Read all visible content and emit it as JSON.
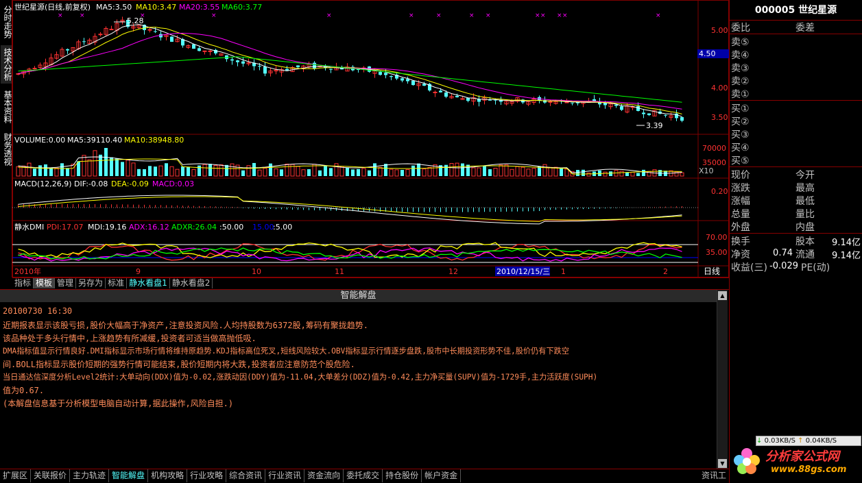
{
  "left_tabs": [
    "分时走势",
    "技术分析",
    "基本资料",
    "财务透视"
  ],
  "main_chart": {
    "title": "世纪星源(日线,前复权)",
    "ma5": "MA5:3.50",
    "ma10": "MA10:3.47",
    "ma20": "MA20:3.55",
    "ma60": "MA60:3.77",
    "high_label": "5.28",
    "low_label": "3.39",
    "price_ticks": [
      "5.00",
      "4.50",
      "4.00",
      "3.50"
    ],
    "current_price_tag": "4.50"
  },
  "volume_chart": {
    "title": "VOLUME:0.00",
    "ma5": "MA5:39110.40",
    "ma10": "MA10:38948.80",
    "ticks": [
      "70000",
      "35000"
    ],
    "unit": "X10"
  },
  "macd_chart": {
    "title": "MACD(12,26,9)",
    "dif": "DIF:-0.08",
    "dea": "DEA:-0.09",
    "macd": "MACD:0.03",
    "ticks": [
      "0.20"
    ]
  },
  "dmi_chart": {
    "title": "静水DMI",
    "pdi": "PDI:17.07",
    "mdi": "MDI:19.16",
    "adx": "ADX:16.12",
    "adxr": "ADXR:26.04",
    "l50": ":50.00",
    "l15": "15.00",
    "l5": ":5.00",
    "ticks": [
      "70.00",
      "35.00"
    ]
  },
  "time_axis": {
    "labels": [
      "2010年",
      "9",
      "10",
      "11",
      "12",
      "1",
      "2"
    ],
    "cursor_date": "2010/12/15/三",
    "period": "日线"
  },
  "chart_tabs": [
    "指标",
    "模板",
    "管理",
    "另存为",
    "标准",
    "静水看盘1",
    "静水看盘2"
  ],
  "quote": {
    "code_name": "000005 世纪星源",
    "weibi": "委比",
    "weicha": "委差",
    "sell": [
      "卖⑤",
      "卖④",
      "卖③",
      "卖②",
      "卖①"
    ],
    "buy": [
      "买①",
      "买②",
      "买③",
      "买④",
      "买⑤"
    ],
    "stats_left": [
      "现价",
      "涨跌",
      "涨幅",
      "总量",
      "外盘"
    ],
    "stats_right": [
      "今开",
      "最高",
      "最低",
      "量比",
      "内盘"
    ],
    "huanshou": "换手",
    "guben": "股本",
    "guben_val": "9.14亿",
    "jingzi": "净资",
    "jingzi_val": "0.74",
    "liutong": "流通",
    "liutong_val": "9.14亿",
    "shouyi": "收益(三)",
    "shouyi_val": "-0.029",
    "pe": "PE(动)"
  },
  "panel": {
    "title": "智能解盘",
    "lines": [
      "20100730 16:30",
      "    近期报表显示该股亏损,股价大幅高于净资产,注意投资风险.人均持股数为6372股,筹码有聚拢趋势.",
      "    该品种处于多头行情中,上涨趋势有所减缓,投资者可适当做高抛低吸.",
      "    DMA指标值显示行情良好.DMI指标显示市场行情将维持原趋势.KDJ指标高位死叉,短线风险较大.OBV指标显示行情逐步盘跌,股市中长期投资形势不佳,股价仍有下跌空",
      "间.BOLL指标显示股价短期的强势行情可能结束,股价短期内将大跌,投资者应注意防范个股危险.",
      "    当日通达信深度分析Level2统计:大单动向(DDX)值为-0.02,涨跌动因(DDY)值为-11.04,大单差分(DDZ)值为-0.42,主力净买量(SUPV)值为-1729手,主力活跃度(SUPH)",
      "值为0.67.",
      "    (本解盘信息基于分析模型电脑自动计算,据此操作,风险自担.)"
    ]
  },
  "bottom_tabs": [
    "扩展区",
    "关联报价",
    "主力轨迹",
    "智能解盘",
    "机构攻略",
    "行业攻略",
    "综合资讯",
    "行业资讯",
    "资金流向",
    "委托成交",
    "持仓股份",
    "帐户资金"
  ],
  "bottom_right": "资讯工",
  "net_speed": {
    "down": "0.03KB/S",
    "up": "0.04KB/S"
  },
  "watermark": {
    "text": "分析家公式网",
    "url": "www.88gs.com"
  },
  "colors": {
    "ma5": "#ffffff",
    "ma10": "#ffff00",
    "ma20": "#ff00ff",
    "ma60": "#00ff00",
    "up": "#ff3232",
    "down": "#54ffff",
    "grid": "#800000"
  }
}
